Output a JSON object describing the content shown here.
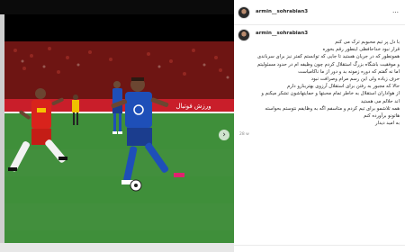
{
  "post": {
    "header": {
      "username": "armin__sohrabian3",
      "more_icon": "ellipsis-icon"
    },
    "comment": {
      "username": "armin__sohrabian3",
      "lines": [
        "با دل پر تیم محبوبم ترک می کنم",
        "قرار نبود خداحافظی اینطور رقم بخوره",
        "همونطور که در جریان هستید تا جایی که توانستم کمتر نیز برای سرباندی",
        "و موفقیت باشگاه بزرگ استقلال کردم چون وظیفه ام در حدود مسئولیتم",
        "اما نه گفتم که دوره زمونه بد و دور از ما ناکامیاست",
        "حرف زیاده ولی این رسم مرام وصرافت نبود",
        "حالا که مجبور به رفتن برای استقلال آرزوی بهترینارو دارم",
        "از هواداران استقلال به خاطر تمام محبتها و حمایتهاشون تشکر میکنم و",
        "اند حلالم می هستید",
        "همه تلاشمو برای تیم کردم و متاسفم اگه به وظایفم نتوستم بحواسته",
        "هاتونو برآورده کنم",
        "به امید دیدار"
      ],
      "timestamp": "28 w"
    }
  },
  "photo": {
    "description_icon": "soccer-match-photo",
    "ad_board_text": "ورزش فوتبال",
    "colors": {
      "pitch": "#3f8f3a",
      "blue_kit": "#1e4fb8",
      "red_kit": "#d8231c",
      "stands": "#7a1412"
    }
  }
}
